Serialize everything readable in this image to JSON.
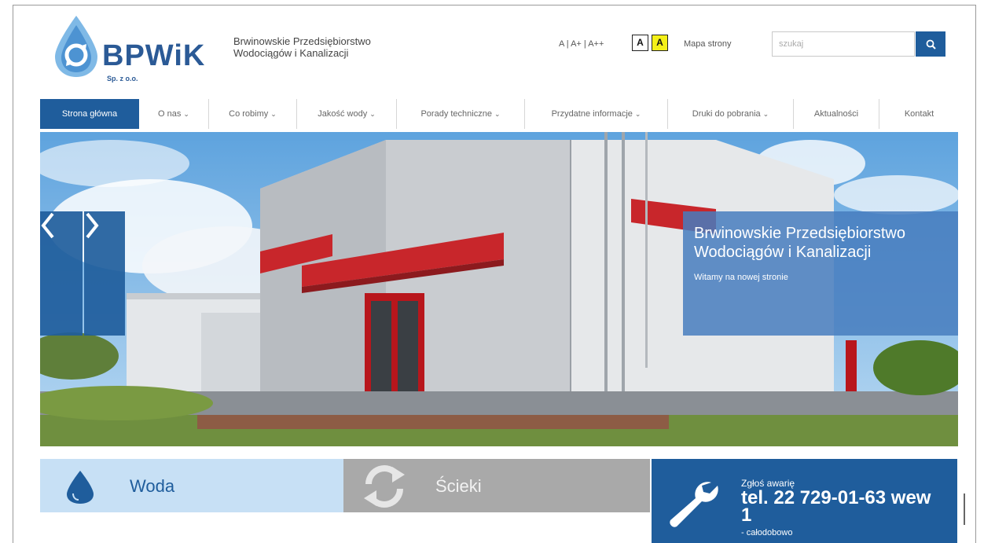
{
  "header": {
    "logo_text": "BPWiK",
    "logo_sub": "Sp. z o.o.",
    "company_name": "Brwinowskie Przedsiębiorstwo Wodociągów i Kanalizacji",
    "font_size_controls": "A | A+ | A++",
    "contrast_normal": "A",
    "contrast_yellow": "A",
    "sitemap_label": "Mapa strony",
    "search_placeholder": "szukaj",
    "search_icon": "search-icon"
  },
  "nav": {
    "items": [
      {
        "label": "Strona główna",
        "dropdown": false,
        "active": true
      },
      {
        "label": "O nas",
        "dropdown": true
      },
      {
        "label": "Co robimy",
        "dropdown": true
      },
      {
        "label": "Jakość wody",
        "dropdown": true
      },
      {
        "label": "Porady techniczne",
        "dropdown": true
      },
      {
        "label": "Przydatne informacje",
        "dropdown": true
      },
      {
        "label": "Druki do pobrania",
        "dropdown": true
      },
      {
        "label": "Aktualności",
        "dropdown": false
      },
      {
        "label": "Kontakt",
        "dropdown": false
      }
    ]
  },
  "hero": {
    "caption_title": "Brwinowskie Przedsiębiorstwo Wodociągów i Kanalizacji",
    "caption_subtitle": "Witamy na nowej stronie",
    "prev_icon": "chevron-left-icon",
    "next_icon": "chevron-right-icon"
  },
  "tiles": {
    "woda": "Woda",
    "scieki": "Ścieki",
    "awaria_pre": "Zgłoś awarię",
    "awaria_tel": "tel. 22 729-01-63 wew 1",
    "awaria_when": "- całodobowo"
  },
  "colors": {
    "brand_blue": "#1f5d9c",
    "light_blue": "#c7e0f5",
    "gray_tile": "#a9a9a9",
    "contrast_yellow": "#f4f018"
  }
}
